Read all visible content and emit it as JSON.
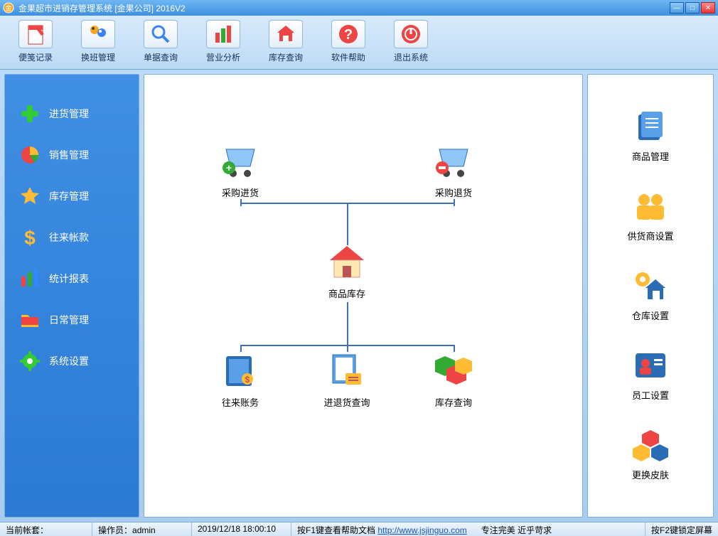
{
  "window": {
    "title": "金果超市进销存管理系统 [金果公司] 2016V2"
  },
  "toolbar": [
    {
      "label": "便笺记录"
    },
    {
      "label": "换班管理"
    },
    {
      "label": "单据查询"
    },
    {
      "label": "营业分析"
    },
    {
      "label": "库存查询"
    },
    {
      "label": "软件帮助"
    },
    {
      "label": "退出系统"
    }
  ],
  "sidebar": [
    {
      "label": "进货管理"
    },
    {
      "label": "销售管理"
    },
    {
      "label": "库存管理"
    },
    {
      "label": "往来帐款"
    },
    {
      "label": "统计报表"
    },
    {
      "label": "日常管理"
    },
    {
      "label": "系统设置"
    }
  ],
  "nodes": {
    "purchase_in": "采购进货",
    "purchase_return": "采购退货",
    "stock": "商品库存",
    "accounts": "往来账务",
    "inout_query": "进退货查询",
    "stock_query": "库存查询"
  },
  "right": [
    {
      "label": "商品管理"
    },
    {
      "label": "供货商设置"
    },
    {
      "label": "仓库设置"
    },
    {
      "label": "员工设置"
    },
    {
      "label": "更换皮肤"
    }
  ],
  "status": {
    "account_set_label": "当前帐套：",
    "operator_label": "操作员：",
    "operator_value": "admin",
    "datetime": "2019/12/18 18:00:10",
    "help_text": "按F1键查看帮助文档",
    "url": "http://www.jsjinguo.com",
    "slogan": "专注完美 近乎苛求",
    "lock": "按F2键锁定屏幕"
  }
}
